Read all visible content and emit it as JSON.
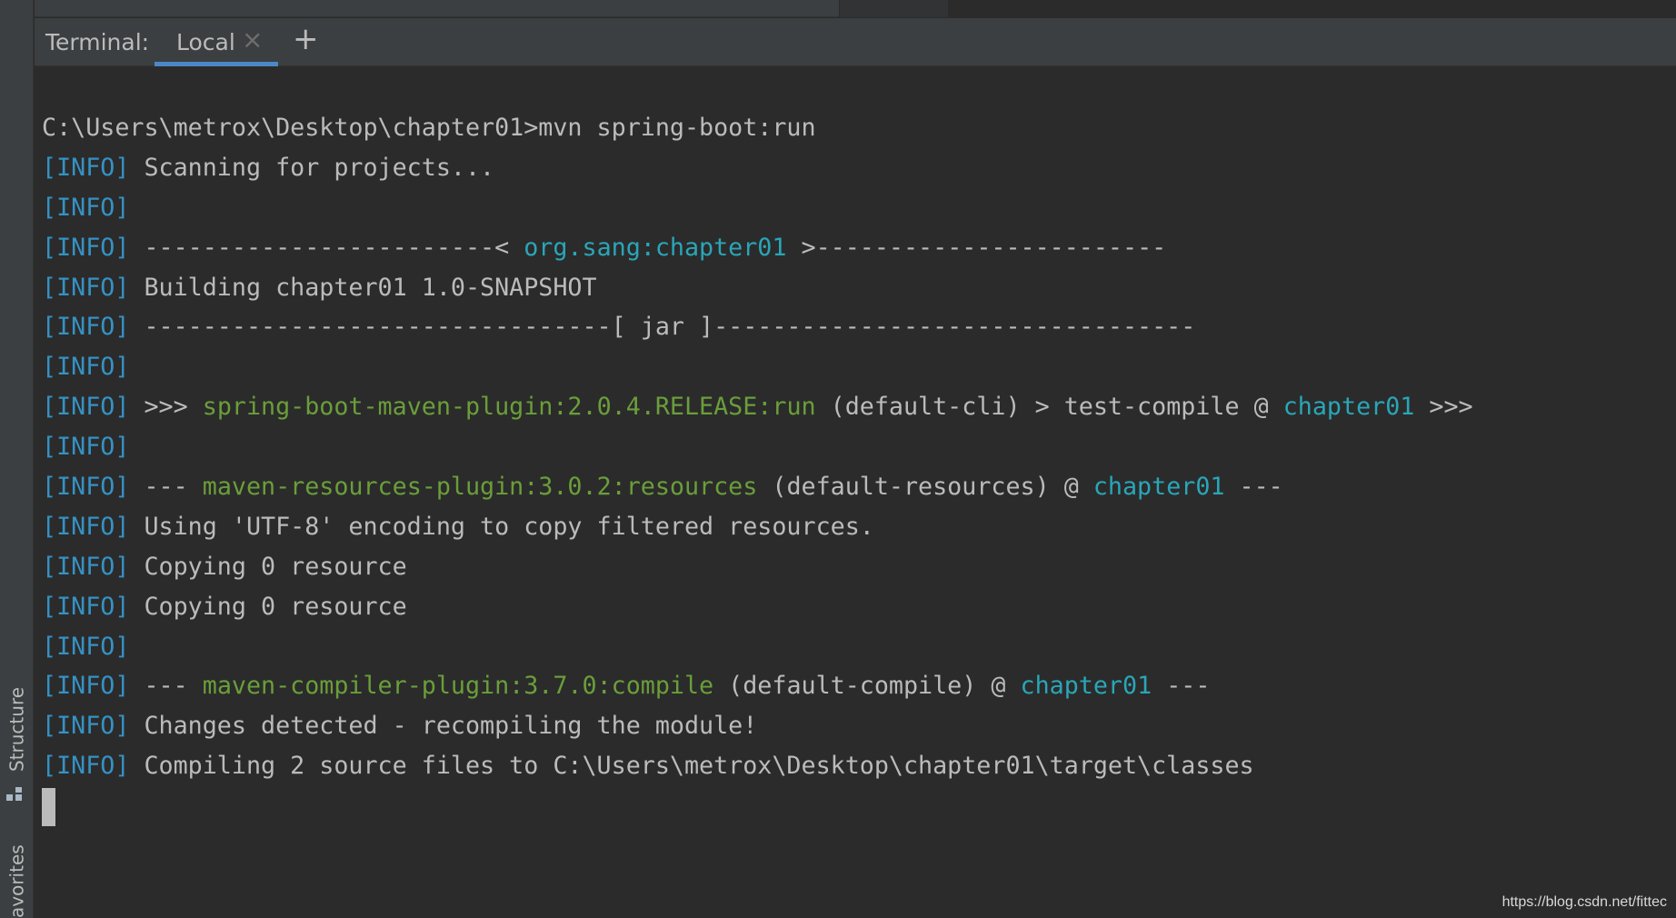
{
  "sidebar": {
    "structure_label": "Structure",
    "favorites_label": "avorites"
  },
  "terminal": {
    "title": "Terminal:",
    "tab_label": "Local",
    "close_glyph": "×",
    "add_glyph": "+"
  },
  "lines": [
    [
      {
        "t": "C:\\Users\\metrox\\Desktop\\chapter01>mvn spring-boot:run",
        "c": "plain"
      }
    ],
    [
      {
        "t": "[INFO]",
        "c": "info"
      },
      {
        "t": " Scanning for projects...",
        "c": "plain"
      }
    ],
    [
      {
        "t": "[INFO]",
        "c": "info"
      }
    ],
    [
      {
        "t": "[INFO]",
        "c": "info"
      },
      {
        "t": " ------------------------< ",
        "c": "plain"
      },
      {
        "t": "org.sang:chapter01",
        "c": "cyan"
      },
      {
        "t": " >------------------------",
        "c": "plain"
      }
    ],
    [
      {
        "t": "[INFO]",
        "c": "info"
      },
      {
        "t": " Building chapter01 1.0-SNAPSHOT",
        "c": "plain"
      }
    ],
    [
      {
        "t": "[INFO]",
        "c": "info"
      },
      {
        "t": " --------------------------------[ jar ]---------------------------------",
        "c": "plain"
      }
    ],
    [
      {
        "t": "[INFO]",
        "c": "info"
      }
    ],
    [
      {
        "t": "[INFO]",
        "c": "info"
      },
      {
        "t": " >>> ",
        "c": "plain"
      },
      {
        "t": "spring-boot-maven-plugin:2.0.4.RELEASE:run",
        "c": "green"
      },
      {
        "t": " (default-cli) > test-compile @ ",
        "c": "plain"
      },
      {
        "t": "chapter01",
        "c": "cyan"
      },
      {
        "t": " >>>",
        "c": "plain"
      }
    ],
    [
      {
        "t": "[INFO]",
        "c": "info"
      }
    ],
    [
      {
        "t": "[INFO]",
        "c": "info"
      },
      {
        "t": " --- ",
        "c": "plain"
      },
      {
        "t": "maven-resources-plugin:3.0.2:resources",
        "c": "green"
      },
      {
        "t": " (default-resources) @ ",
        "c": "plain"
      },
      {
        "t": "chapter01",
        "c": "cyan"
      },
      {
        "t": " ---",
        "c": "plain"
      }
    ],
    [
      {
        "t": "[INFO]",
        "c": "info"
      },
      {
        "t": " Using 'UTF-8' encoding to copy filtered resources.",
        "c": "plain"
      }
    ],
    [
      {
        "t": "[INFO]",
        "c": "info"
      },
      {
        "t": " Copying 0 resource",
        "c": "plain"
      }
    ],
    [
      {
        "t": "[INFO]",
        "c": "info"
      },
      {
        "t": " Copying 0 resource",
        "c": "plain"
      }
    ],
    [
      {
        "t": "[INFO]",
        "c": "info"
      }
    ],
    [
      {
        "t": "[INFO]",
        "c": "info"
      },
      {
        "t": " --- ",
        "c": "plain"
      },
      {
        "t": "maven-compiler-plugin:3.7.0:compile",
        "c": "green"
      },
      {
        "t": " (default-compile) @ ",
        "c": "plain"
      },
      {
        "t": "chapter01",
        "c": "cyan"
      },
      {
        "t": " ---",
        "c": "plain"
      }
    ],
    [
      {
        "t": "[INFO]",
        "c": "info"
      },
      {
        "t": " Changes detected - recompiling the module!",
        "c": "plain"
      }
    ],
    [
      {
        "t": "[INFO]",
        "c": "info"
      },
      {
        "t": " Compiling 2 source files to C:\\Users\\metrox\\Desktop\\chapter01\\target\\classes",
        "c": "plain"
      }
    ]
  ],
  "watermark": "https://blog.csdn.net/fittec",
  "colors": {
    "background": "#2b2b2b",
    "info": "#3592c4",
    "plugin": "#6a9e3a",
    "artifact": "#29a6b8",
    "text": "#bbbbbb",
    "tab_underline": "#4a88c7"
  }
}
